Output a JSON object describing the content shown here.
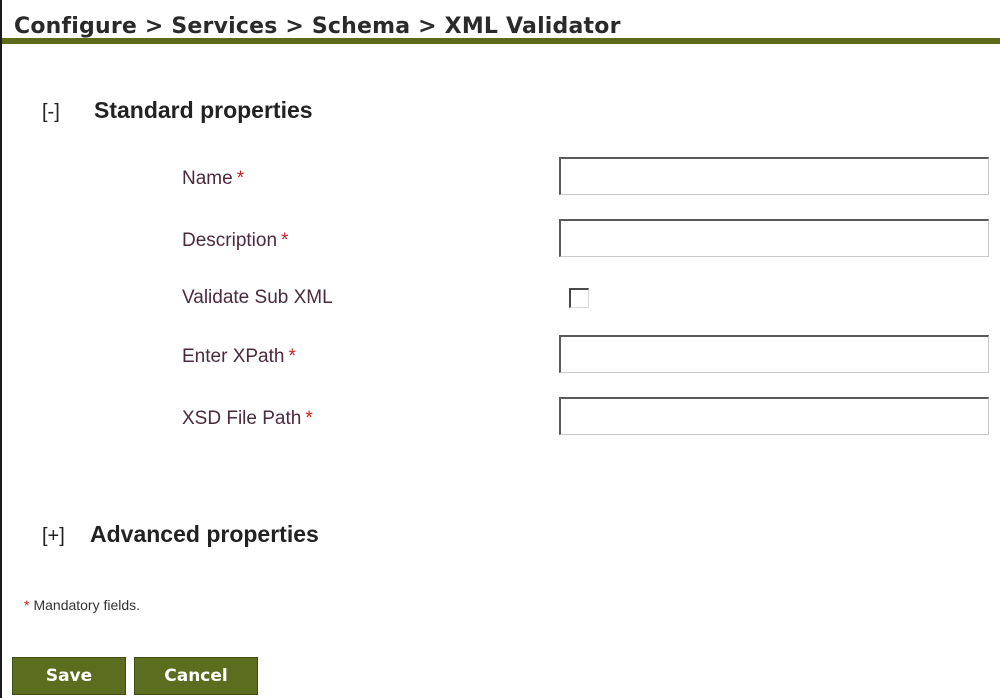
{
  "breadcrumb": "Configure > Services > Schema > XML Validator",
  "standard_section": {
    "toggle": "[-]",
    "title": "Standard properties"
  },
  "fields": {
    "name": {
      "label": "Name",
      "required_mark": "*",
      "value": ""
    },
    "description": {
      "label": "Description",
      "required_mark": "*",
      "value": ""
    },
    "validate_sub_xml": {
      "label": "Validate Sub XML",
      "checked": false
    },
    "xpath": {
      "label": "Enter XPath",
      "required_mark": "*",
      "value": ""
    },
    "xsd_file_path": {
      "label": "XSD File Path",
      "required_mark": "*",
      "value": ""
    }
  },
  "advanced_section": {
    "toggle": "[+]",
    "title": "Advanced properties"
  },
  "mandatory_note": {
    "mark": "*",
    "text": "Mandatory fields."
  },
  "buttons": {
    "save": "Save",
    "cancel": "Cancel"
  },
  "colors": {
    "header_rule": "#5d6a17",
    "button_bg": "#5b6e1f",
    "label_text": "#4a2a3e",
    "required_mark": "#cc2222"
  }
}
